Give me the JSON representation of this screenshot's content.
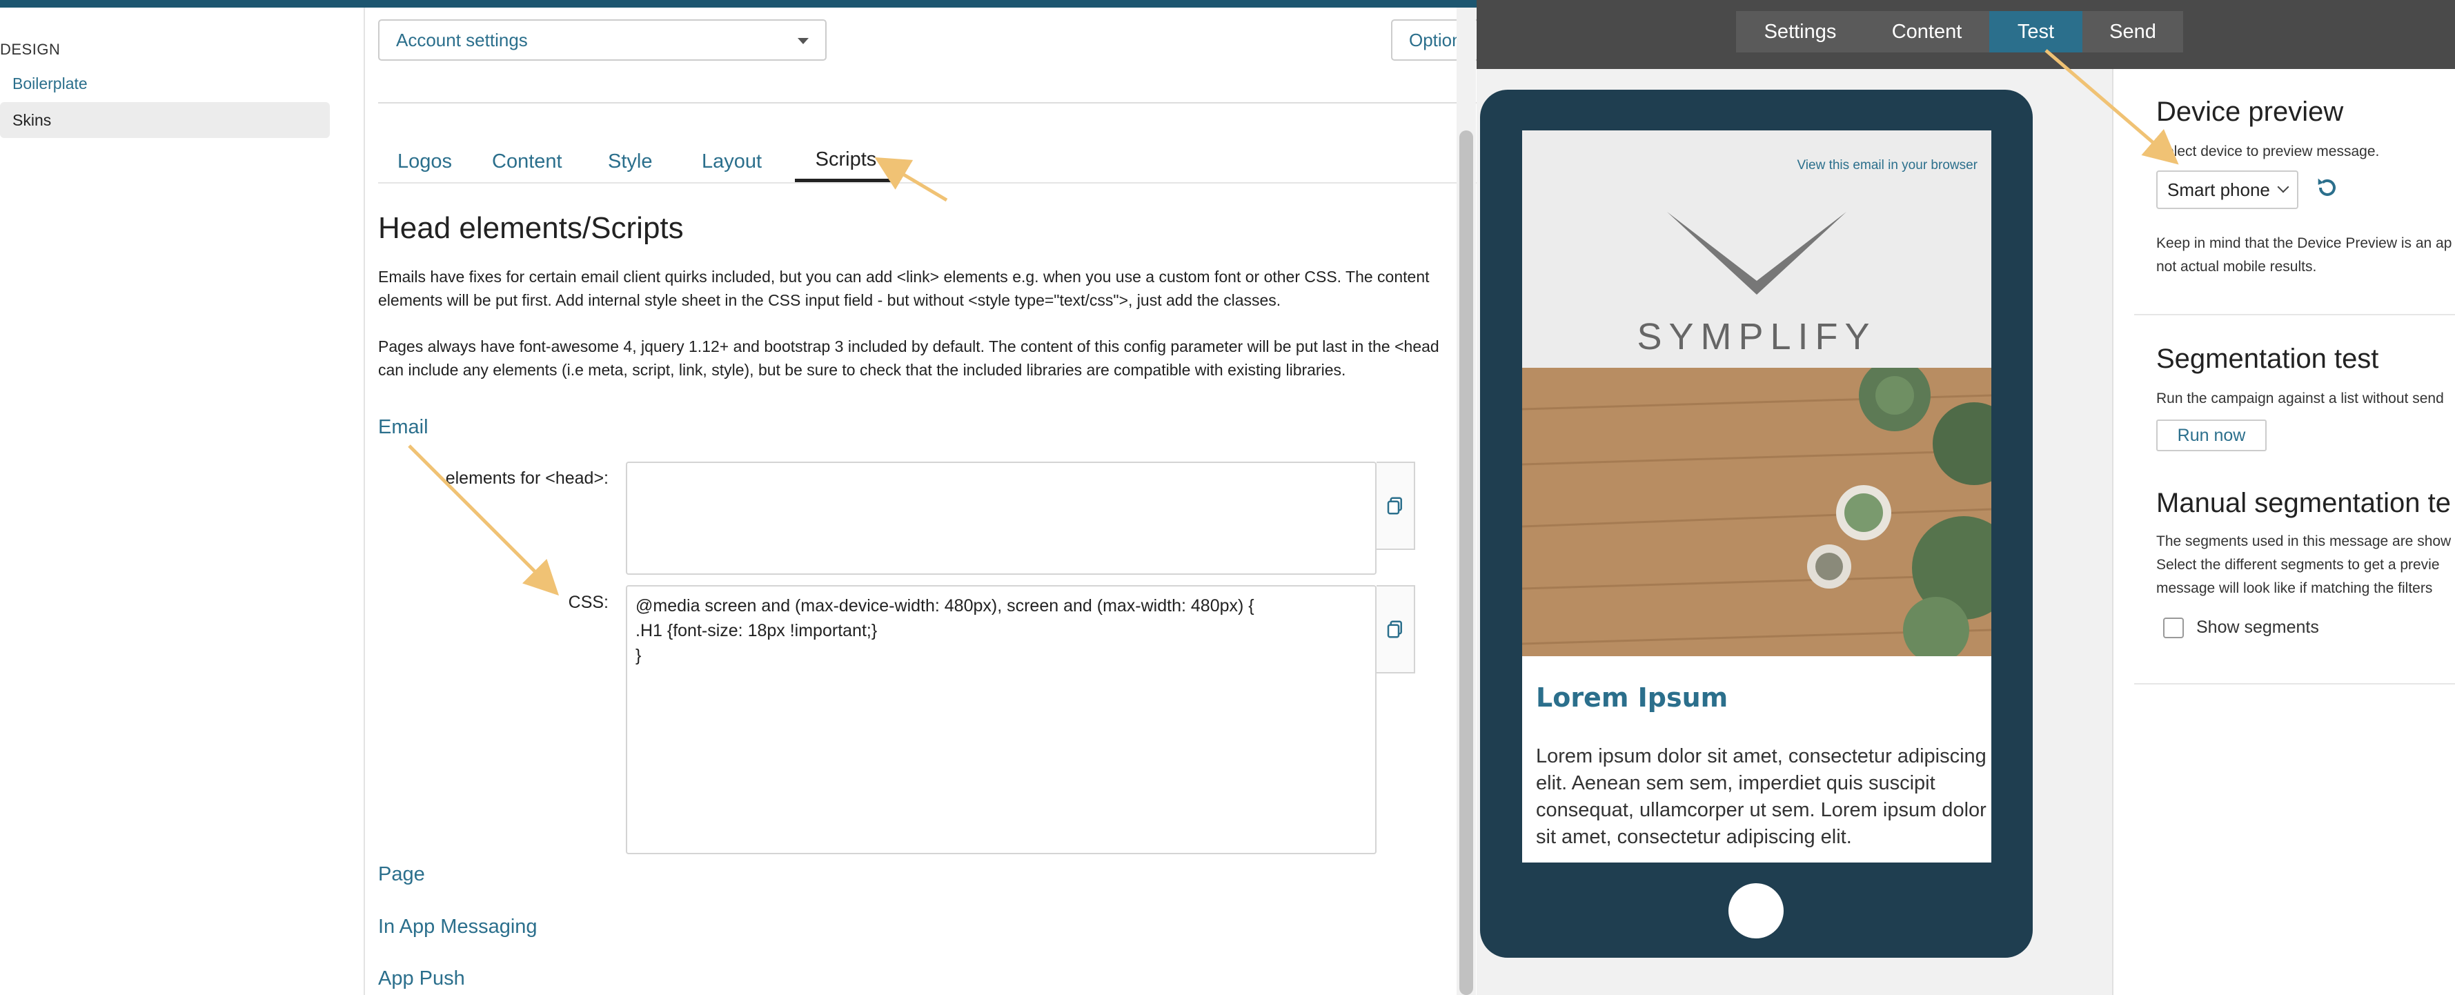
{
  "sidebar": {
    "heading": "DESIGN",
    "items": [
      {
        "label": "Boilerplate",
        "active": false
      },
      {
        "label": "Skins",
        "active": true
      }
    ]
  },
  "settings": {
    "account_select": "Account settings",
    "options_label": "Options",
    "tabs": [
      {
        "label": "Logos",
        "active": false
      },
      {
        "label": "Content",
        "active": false
      },
      {
        "label": "Style",
        "active": false
      },
      {
        "label": "Layout",
        "active": false
      },
      {
        "label": "Scripts",
        "active": true
      }
    ],
    "section_title": "Head elements/Scripts",
    "para1_line1": "Emails have fixes for certain email client quirks included, but you can add <link> elements e.g. when you use a custom font or other CSS. The content",
    "para1_line2": "elements will be put first. Add internal style sheet in the CSS input field - but without <style type=\"text/css\">, just add the classes.",
    "para2_line1": "Pages always have font-awesome 4, jquery 1.12+ and bootstrap 3 included by default. The content of this config parameter will be put last in the <head",
    "para2_line2": "can include any elements (i.e meta, script, link, style), but be sure to check that the included libraries are compatible with existing libraries.",
    "email_group": "Email",
    "head_label": "elements for <head>:",
    "head_value": "",
    "css_label": "CSS:",
    "css_value": "@media screen and (max-device-width: 480px), screen and (max-width: 480px) {\n.H1 {font-size: 18px !important;}\n}",
    "page_group": "Page",
    "in_app_group": "In App Messaging",
    "app_push_group": "App Push"
  },
  "preview": {
    "tabs": [
      {
        "label": "Settings",
        "active": false
      },
      {
        "label": "Content",
        "active": false
      },
      {
        "label": "Test",
        "active": true
      },
      {
        "label": "Send",
        "active": false
      }
    ],
    "email": {
      "view_link": "View this email in your browser",
      "logo_text": "SYMPLIFY",
      "heading": "Lorem Ipsum",
      "body": "Lorem ipsum dolor sit amet, consectetur adipiscing\nelit. Aenean sem sem, imperdiet quis suscipit\nconsequat, ullamcorper ut sem. Lorem ipsum dolor\nsit amet, consectetur adipiscing elit."
    },
    "device_preview": {
      "title": "Device preview",
      "hint": "Select device to preview message.",
      "device_select": "Smart phone",
      "note": "Keep in mind that the Device Preview is an ap\nnot actual mobile results."
    },
    "segmentation_test": {
      "title": "Segmentation test",
      "text": "Run the campaign against a list without send",
      "button": "Run now"
    },
    "manual_segmentation": {
      "title": "Manual segmentation te",
      "text": "The segments used in this message are show\nSelect the different segments to get a previe\nmessage will look like if matching the filters",
      "checkbox_label": "Show segments",
      "checked": false
    }
  },
  "colors": {
    "accent": "#2b6f8c",
    "device_frame": "#1f3e50",
    "annotation_arrow": "#f0c274",
    "topbar": "#4a4a4a"
  }
}
